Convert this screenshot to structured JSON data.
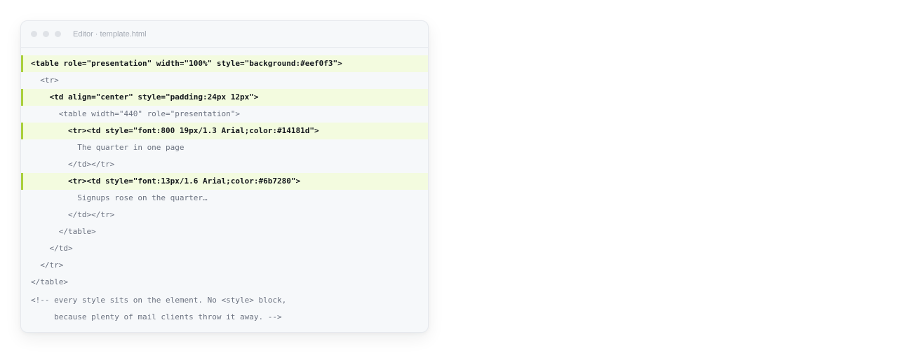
{
  "window": {
    "title": "Editor · template.html"
  },
  "code_lines": [
    {
      "indent": 0,
      "text": "<table role=\"presentation\" width=\"100%\" style=\"background:#eef0f3\">",
      "highlight": true
    },
    {
      "indent": 1,
      "text": "<tr>",
      "highlight": false
    },
    {
      "indent": 2,
      "text": "<td align=\"center\" style=\"padding:24px 12px\">",
      "highlight": true
    },
    {
      "indent": 3,
      "text": "<table width=\"440\" role=\"presentation\">",
      "highlight": false
    },
    {
      "indent": 4,
      "text": "<tr><td style=\"font:800 19px/1.3 Arial;color:#14181d\">",
      "highlight": true
    },
    {
      "indent": 5,
      "text": "The quarter in one page",
      "highlight": false
    },
    {
      "indent": 4,
      "text": "</td></tr>",
      "highlight": false
    },
    {
      "indent": 4,
      "text": "<tr><td style=\"font:13px/1.6 Arial;color:#6b7280\">",
      "highlight": true
    },
    {
      "indent": 5,
      "text": "Signups rose on the quarter…",
      "highlight": false
    },
    {
      "indent": 4,
      "text": "</td></tr>",
      "highlight": false
    },
    {
      "indent": 3,
      "text": "</table>",
      "highlight": false
    },
    {
      "indent": 2,
      "text": "</td>",
      "highlight": false
    },
    {
      "indent": 1,
      "text": "</tr>",
      "highlight": false
    },
    {
      "indent": 0,
      "text": "</table>",
      "highlight": false
    }
  ],
  "comment_lines": [
    {
      "indent": 0,
      "text": "<!-- every style sits on the element. No <style> block,"
    },
    {
      "indent": 0,
      "text": "     because plenty of mail clients throw it away. -->"
    }
  ],
  "colors": {
    "highlight_bg": "#f3fbdf",
    "highlight_bar": "#a9cf3b",
    "strong_text": "#14181d",
    "muted_text": "#6b7280",
    "editor_bg": "#f6f8fa"
  }
}
